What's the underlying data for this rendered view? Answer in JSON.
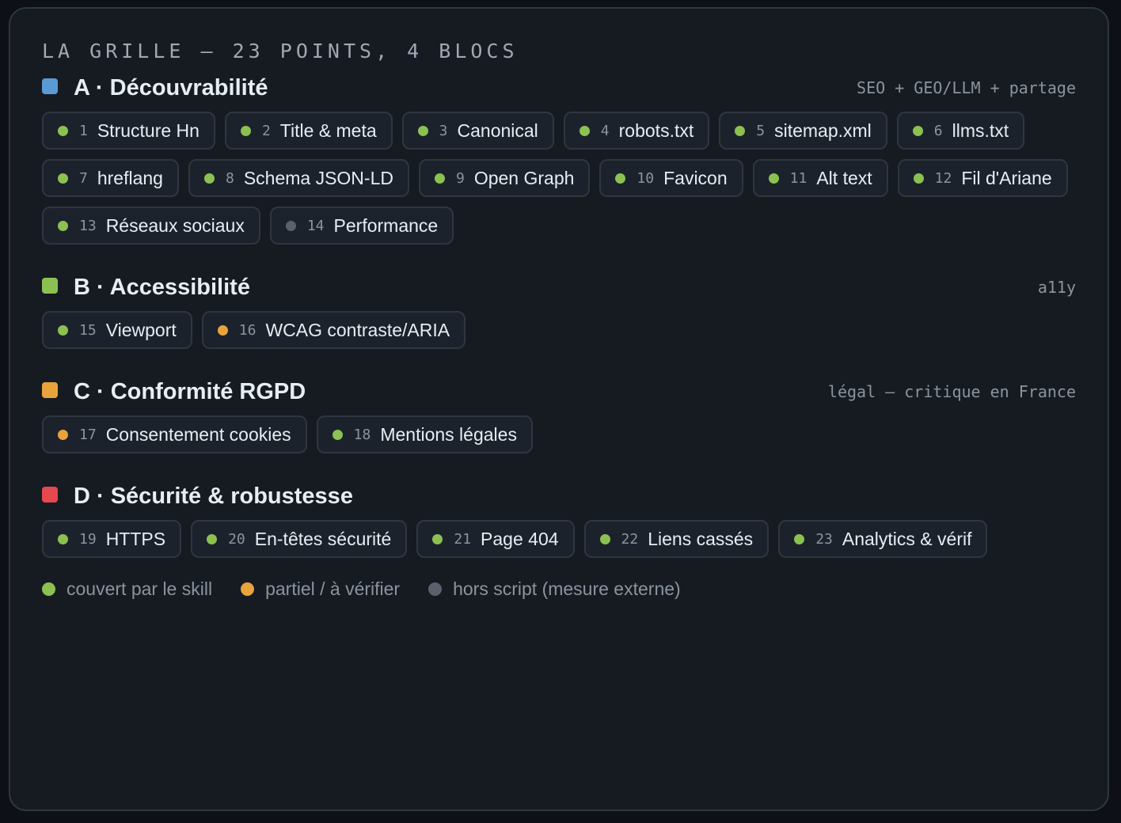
{
  "title": "LA GRILLE — 23 POINTS, 4 BLOCS",
  "colors": {
    "covered": "#8cc152",
    "partial": "#e8a33d",
    "external": "#5a616b",
    "block_a": "#5b9bd5",
    "block_b": "#8cc152",
    "block_c": "#e8a33d",
    "block_d": "#e5484d"
  },
  "blocks": [
    {
      "name": "A · Découvrabilité",
      "note": "SEO + GEO/LLM + partage",
      "color": "#5b9bd5",
      "items": [
        {
          "num": "1",
          "label": "Structure Hn",
          "status": "covered"
        },
        {
          "num": "2",
          "label": "Title & meta",
          "status": "covered"
        },
        {
          "num": "3",
          "label": "Canonical",
          "status": "covered"
        },
        {
          "num": "4",
          "label": "robots.txt",
          "status": "covered"
        },
        {
          "num": "5",
          "label": "sitemap.xml",
          "status": "covered"
        },
        {
          "num": "6",
          "label": "llms.txt",
          "status": "covered"
        },
        {
          "num": "7",
          "label": "hreflang",
          "status": "covered"
        },
        {
          "num": "8",
          "label": "Schema JSON-LD",
          "status": "covered"
        },
        {
          "num": "9",
          "label": "Open Graph",
          "status": "covered"
        },
        {
          "num": "10",
          "label": "Favicon",
          "status": "covered"
        },
        {
          "num": "11",
          "label": "Alt text",
          "status": "covered"
        },
        {
          "num": "12",
          "label": "Fil d'Ariane",
          "status": "covered"
        },
        {
          "num": "13",
          "label": "Réseaux sociaux",
          "status": "covered"
        },
        {
          "num": "14",
          "label": "Performance",
          "status": "external"
        }
      ]
    },
    {
      "name": "B · Accessibilité",
      "note": "a11y",
      "color": "#8cc152",
      "items": [
        {
          "num": "15",
          "label": "Viewport",
          "status": "covered"
        },
        {
          "num": "16",
          "label": "WCAG contraste/ARIA",
          "status": "partial"
        }
      ]
    },
    {
      "name": "C · Conformité RGPD",
      "note": "légal — critique en France",
      "color": "#e8a33d",
      "items": [
        {
          "num": "17",
          "label": "Consentement cookies",
          "status": "partial"
        },
        {
          "num": "18",
          "label": "Mentions légales",
          "status": "covered"
        }
      ]
    },
    {
      "name": "D · Sécurité & robustesse",
      "note": "",
      "color": "#e5484d",
      "items": [
        {
          "num": "19",
          "label": "HTTPS",
          "status": "covered"
        },
        {
          "num": "20",
          "label": "En-têtes sécurité",
          "status": "covered"
        },
        {
          "num": "21",
          "label": "Page 404",
          "status": "covered"
        },
        {
          "num": "22",
          "label": "Liens cassés",
          "status": "covered"
        },
        {
          "num": "23",
          "label": "Analytics & vérif",
          "status": "covered"
        }
      ]
    }
  ],
  "legend": [
    {
      "status": "covered",
      "label": "couvert par le skill"
    },
    {
      "status": "partial",
      "label": "partiel / à vérifier"
    },
    {
      "status": "external",
      "label": "hors script (mesure externe)"
    }
  ]
}
